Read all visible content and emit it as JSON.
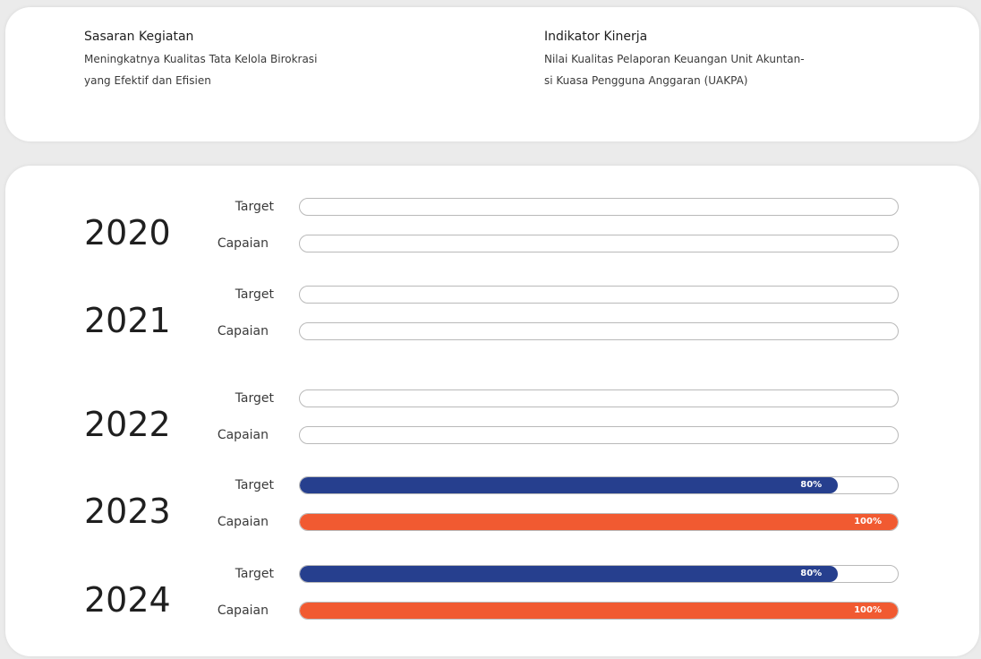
{
  "header": {
    "sasaran_title": "Sasaran Kegiatan",
    "sasaran_line1": "Meningkatnya Kualitas Tata Kelola Birokrasi",
    "sasaran_line2": "yang Efektif dan Efisien",
    "indikator_title": "Indikator Kinerja",
    "indikator_line1": "Nilai Kualitas Pelaporan Keuangan Unit Akuntan-",
    "indikator_line2": "si Kuasa Pengguna Anggaran (UAKPA)"
  },
  "colors": {
    "target": "#263f8e",
    "capaian": "#f15a31",
    "track_border": "#b9b9b9"
  },
  "chart_data": {
    "type": "bar",
    "orientation": "horizontal",
    "categories": [
      "2020",
      "2021",
      "2022",
      "2023",
      "2024"
    ],
    "series": [
      {
        "name": "Target",
        "values": [
          null,
          null,
          null,
          80,
          80
        ]
      },
      {
        "name": "Capaian",
        "values": [
          null,
          null,
          null,
          100,
          100
        ]
      }
    ],
    "value_labels": {
      "Target": [
        "",
        "",
        "",
        "80%",
        "80%"
      ],
      "Capaian": [
        "",
        "",
        "",
        "100%",
        "100%"
      ]
    },
    "xlim": [
      0,
      100
    ],
    "grid": false
  }
}
